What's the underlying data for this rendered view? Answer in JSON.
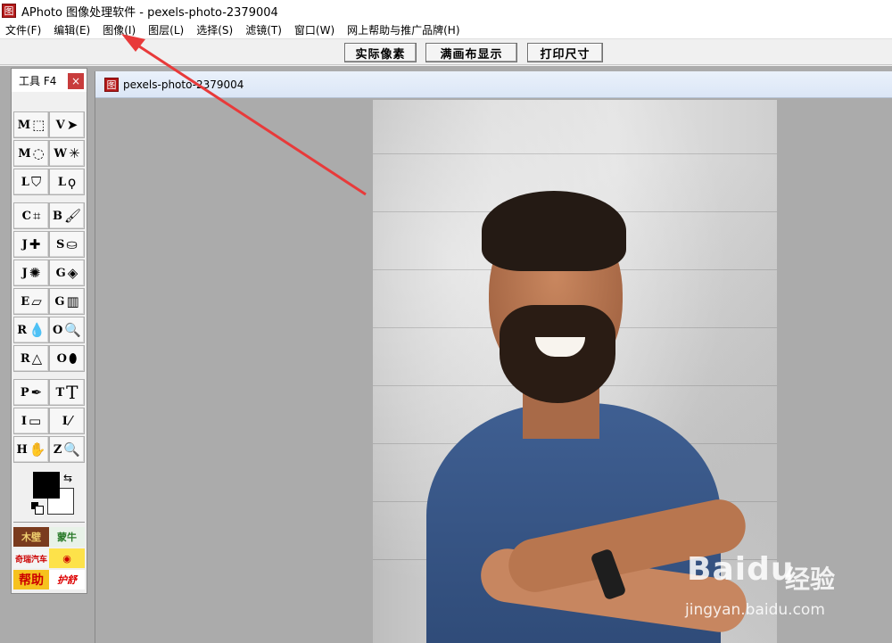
{
  "window": {
    "title": "APhoto 图像处理软件 - pexels-photo-2379004",
    "icon_glyph": "图"
  },
  "menu": [
    {
      "label": "文件(F)"
    },
    {
      "label": "编辑(E)"
    },
    {
      "label": "图像(I)"
    },
    {
      "label": "图层(L)"
    },
    {
      "label": "选择(S)"
    },
    {
      "label": "滤镜(T)"
    },
    {
      "label": "窗口(W)"
    },
    {
      "label": "网上帮助与推广品牌(H)"
    }
  ],
  "toolbar": {
    "actual_pixels": "实际像素",
    "fit_canvas": "满画布显示",
    "print_size": "打印尺寸"
  },
  "tool_panel": {
    "title": "工具 F4",
    "close": "×",
    "tools": [
      {
        "key": "M",
        "glyph": "⬚"
      },
      {
        "key": "V",
        "glyph": "➤"
      },
      {
        "key": "M",
        "glyph": "◌"
      },
      {
        "key": "W",
        "glyph": "✳"
      },
      {
        "key": "L",
        "glyph": "⛉"
      },
      {
        "key": "L",
        "glyph": "ϙ"
      },
      {
        "key": "C",
        "glyph": "⌗"
      },
      {
        "key": "B",
        "glyph": "🖌"
      },
      {
        "key": "J",
        "glyph": "✚"
      },
      {
        "key": "S",
        "glyph": "⛀"
      },
      {
        "key": "J",
        "glyph": "✺"
      },
      {
        "key": "G",
        "glyph": "◈"
      },
      {
        "key": "E",
        "glyph": "▱"
      },
      {
        "key": "G",
        "glyph": "▥"
      },
      {
        "key": "R",
        "glyph": "💧"
      },
      {
        "key": "O",
        "glyph": "🔍"
      },
      {
        "key": "R",
        "glyph": "△"
      },
      {
        "key": "O",
        "glyph": "⬮"
      },
      {
        "key": "P",
        "glyph": "✒"
      },
      {
        "key": "T",
        "glyph": "T"
      },
      {
        "key": "I",
        "glyph": "▭"
      },
      {
        "key": "I",
        "glyph": "⁄"
      },
      {
        "key": "H",
        "glyph": "✋"
      },
      {
        "key": "Z",
        "glyph": "🔍"
      }
    ],
    "swap_glyph": "⇆",
    "ads": [
      "木壁",
      "蒙牛",
      "奇瑞汽车",
      "◉",
      "帮助",
      "护舒"
    ]
  },
  "document": {
    "icon_glyph": "图",
    "name": "pexels-photo-2379004"
  },
  "watermark": {
    "brand": "Bai",
    "brand_mid": "du",
    "cn": "经验",
    "url": "jingyan.baidu.com"
  },
  "colors": {
    "foreground": "#000000",
    "background": "#ffffff",
    "annotation_arrow": "#e83a3a"
  }
}
